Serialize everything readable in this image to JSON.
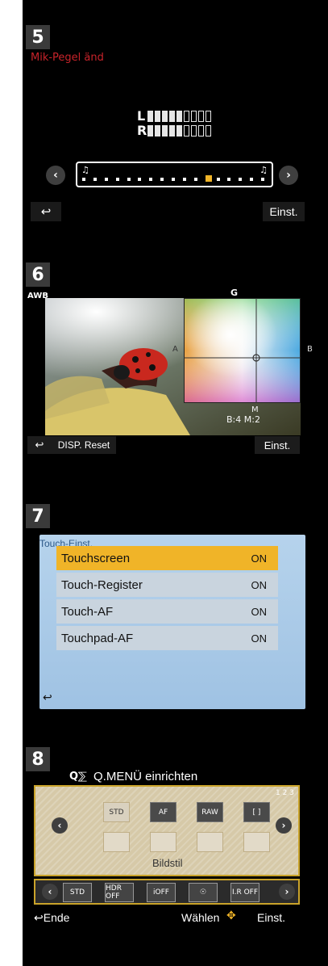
{
  "panel5": {
    "badge": "5",
    "title": "Mik-Pegel änd",
    "left_label": "L",
    "right_label": "R",
    "left_level_on": 5,
    "right_level_on": 5,
    "level_total": 9,
    "prev_arrow": "‹",
    "next_arrow": "›",
    "slider_value": 11,
    "slider_steps": 17,
    "back_icon": "↩",
    "set_label": "Einst."
  },
  "panel6": {
    "badge": "6",
    "awb_label": "AWB",
    "axis_top": "G",
    "axis_left": "A",
    "axis_right": "B",
    "axis_bottom": "M",
    "readout": "B:4 M:2",
    "back_icon": "↩",
    "reset_label": "DISP. Reset",
    "set_label": "Einst."
  },
  "panel7": {
    "badge": "7",
    "title": "Touch-Einst.",
    "rows": [
      {
        "label": "Touchscreen",
        "value": "ON"
      },
      {
        "label": "Touch-Register",
        "value": "ON"
      },
      {
        "label": "Touch-AF",
        "value": "ON"
      },
      {
        "label": "Touchpad-AF",
        "value": "ON"
      }
    ],
    "back_icon": "↩"
  },
  "panel8": {
    "badge": "8",
    "title_icon": "Q⅀",
    "title": "Q.MENÜ einrichten",
    "page_indicator": "1 2 3",
    "prev_arrow": "‹",
    "next_arrow": "›",
    "top_items": [
      "STD",
      "AF",
      "RAW",
      "[ ]"
    ],
    "selected_label": "Bildstil",
    "bottom_items": [
      "STD",
      "HDR OFF",
      "iOFF",
      "☉",
      "I.R OFF"
    ],
    "end_label": "↩Ende",
    "choose_label": "Wählen",
    "set_label": "Einst."
  }
}
